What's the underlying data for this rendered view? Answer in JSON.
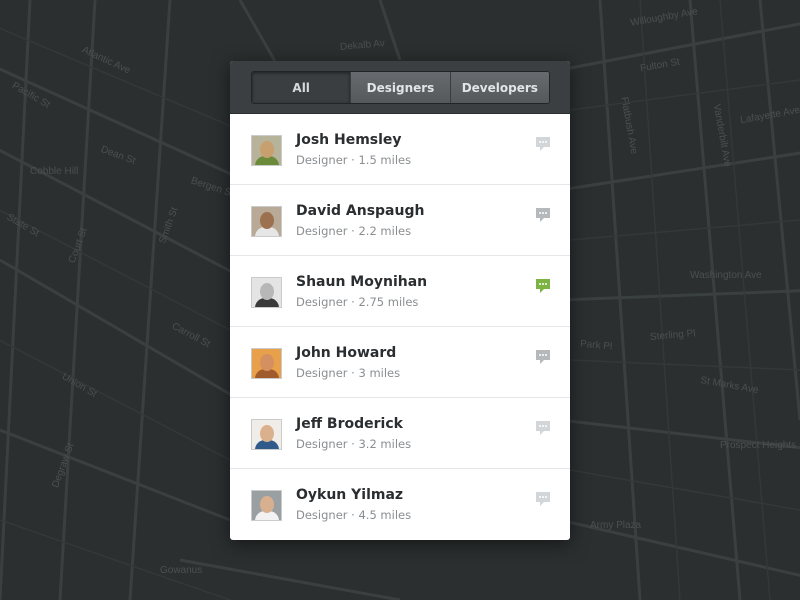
{
  "map": {
    "labels": [
      "Willoughby Ave",
      "Dekalb Av",
      "Cobble Hill",
      "Prospect Heights",
      "Bergen St",
      "Dean St",
      "Atlantic Ave",
      "Pacific St",
      "Union St",
      "Carroll St",
      "Gowanus",
      "Court St",
      "Smith St",
      "Flatbush Ave",
      "Washington Ave",
      "Lafayette Ave",
      "Fulton St",
      "State St",
      "Park Pl",
      "Army Plaza",
      "Sterling Pl",
      "St Marks Ave",
      "Degraw St",
      "Vanderbilt Ave"
    ]
  },
  "tabs": [
    {
      "label": "All",
      "active": true
    },
    {
      "label": "Designers",
      "active": false
    },
    {
      "label": "Developers",
      "active": false
    }
  ],
  "people": [
    {
      "name": "Josh Hemsley",
      "meta": "Designer · 1.5 miles",
      "chat_icon": "chat-bubble-icon",
      "chat_color": "#d3d6d8",
      "face": "#c8a070",
      "body": "#6b8a3a",
      "bg": "#b7b29a"
    },
    {
      "name": "David Anspaugh",
      "meta": "Designer · 2.2 miles",
      "chat_icon": "chat-bubble-icon",
      "chat_color": "#b5b9bc",
      "face": "#9c7150",
      "body": "#e6e6e6",
      "bg": "#b9aa98"
    },
    {
      "name": "Shaun Moynihan",
      "meta": "Designer · 2.75 miles",
      "chat_icon": "chat-bubble-icon",
      "chat_color": "#7cb342",
      "face": "#b7b7b7",
      "body": "#3a3a3a",
      "bg": "#e4e4e4"
    },
    {
      "name": "John Howard",
      "meta": "Designer · 3 miles",
      "chat_icon": "chat-bubble-icon",
      "chat_color": "#b5b9bc",
      "face": "#d49060",
      "body": "#a05a2c",
      "bg": "#e8a04a"
    },
    {
      "name": "Jeff Broderick",
      "meta": "Designer · 3.2 miles",
      "chat_icon": "chat-bubble-icon",
      "chat_color": "#d3d6d8",
      "face": "#dbb08c",
      "body": "#2f5a8a",
      "bg": "#f0ede8"
    },
    {
      "name": "Oykun Yilmaz",
      "meta": "Designer · 4.5 miles",
      "chat_icon": "chat-bubble-icon",
      "chat_color": "#d3d6d8",
      "face": "#d8b090",
      "body": "#f2f2f2",
      "bg": "#9aa0a2"
    }
  ]
}
